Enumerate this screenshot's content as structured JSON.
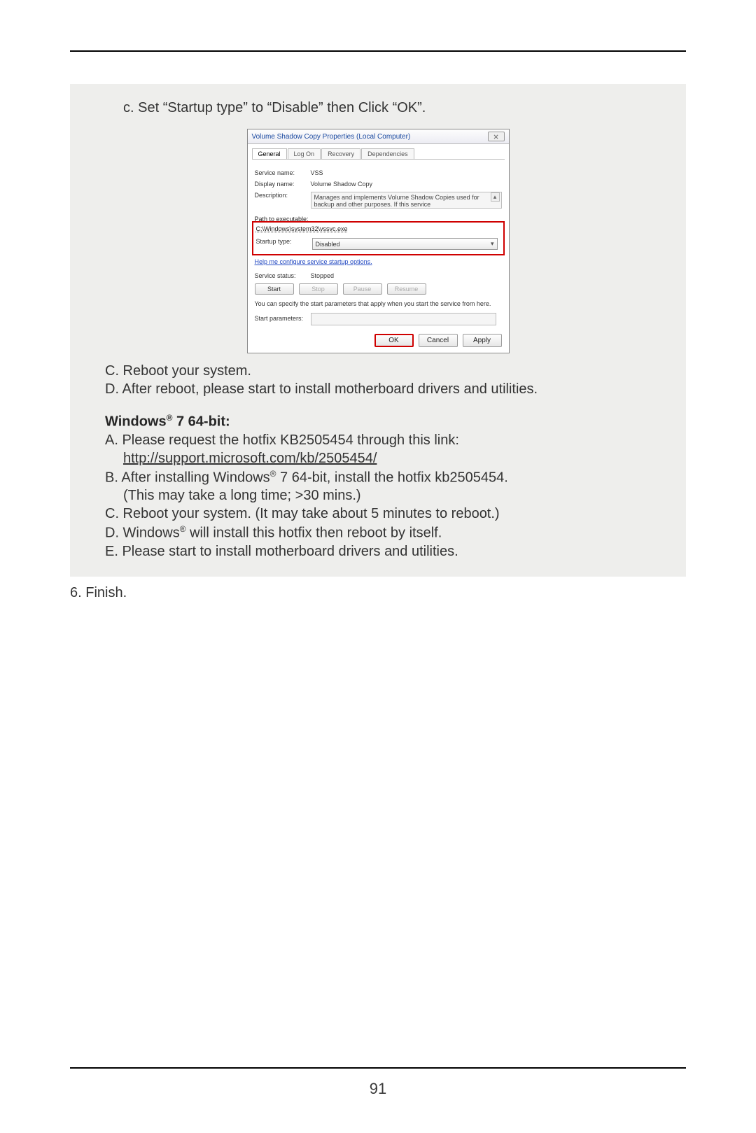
{
  "page_number": "91",
  "box": {
    "step_c": "c. Set “Startup type” to “Disable” then Click “OK”.",
    "C": "C. Reboot your system.",
    "D": "D. After reboot, please start to install motherboard drivers and utilities.",
    "heading_prefix": "Windows",
    "heading_suffix": " 7 64-bit:",
    "A": "A. Please request the hotfix KB2505454 through this link:",
    "A_link": "http://support.microsoft.com/kb/2505454/",
    "B_prefix": "B. After installing Windows",
    "B_suffix": " 7 64-bit, install the hotfix kb2505454.",
    "B_note": "(This may take a long time; >30 mins.)",
    "C2": "C. Reboot your system. (It may take about 5 minutes to reboot.)",
    "D2_prefix": "D. Windows",
    "D2_suffix": " will install this hotfix then reboot by itself.",
    "E": "E. Please start to install motherboard drivers and utilities."
  },
  "after_box": "6. Finish.",
  "dialog": {
    "title": "Volume Shadow Copy Properties (Local Computer)",
    "tabs": {
      "general": "General",
      "logon": "Log On",
      "recovery": "Recovery",
      "dependencies": "Dependencies"
    },
    "service_name_lbl": "Service name:",
    "service_name_val": "VSS",
    "display_name_lbl": "Display name:",
    "display_name_val": "Volume Shadow Copy",
    "description_lbl": "Description:",
    "description_val": "Manages and implements Volume Shadow Copies used for backup and other purposes. If this service",
    "path_lbl": "Path to executable:",
    "path_val": "C:\\Windows\\system32\\vssvc.exe",
    "startup_lbl": "Startup type:",
    "startup_val": "Disabled",
    "help_link": "Help me configure service startup options.",
    "status_lbl": "Service status:",
    "status_val": "Stopped",
    "start": "Start",
    "stop": "Stop",
    "pause": "Pause",
    "resume": "Resume",
    "note": "You can specify the start parameters that apply when you start the service from here.",
    "start_params_lbl": "Start parameters:",
    "ok": "OK",
    "cancel": "Cancel",
    "apply": "Apply"
  },
  "reg_symbol": "®"
}
